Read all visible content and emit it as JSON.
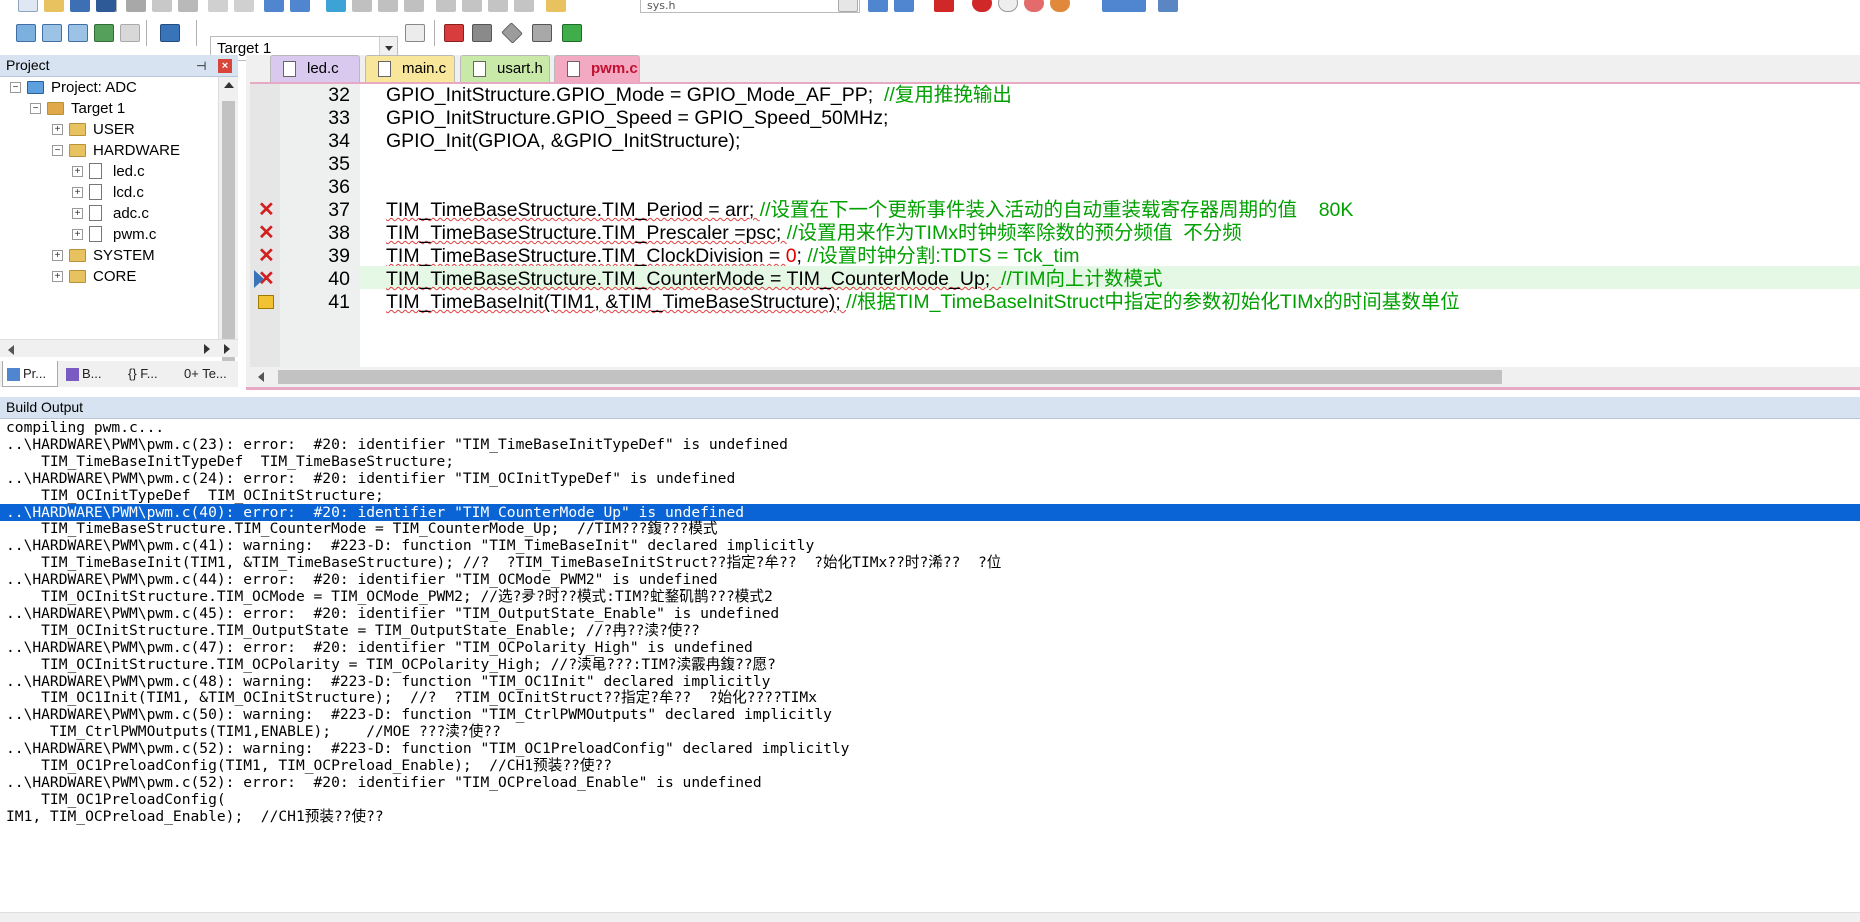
{
  "toolbar": {
    "target_name": "Target 1",
    "top_file": "sys.h"
  },
  "project": {
    "header": "Project",
    "tree": [
      {
        "label": "Project: ADC",
        "depth": 0,
        "type": "project",
        "expander": "−"
      },
      {
        "label": "Target 1",
        "depth": 1,
        "type": "target",
        "expander": "−"
      },
      {
        "label": "USER",
        "depth": 2,
        "type": "folder",
        "expander": "+"
      },
      {
        "label": "HARDWARE",
        "depth": 2,
        "type": "folder",
        "expander": "−"
      },
      {
        "label": "led.c",
        "depth": 3,
        "type": "file",
        "expander": "+"
      },
      {
        "label": "lcd.c",
        "depth": 3,
        "type": "file",
        "expander": "+"
      },
      {
        "label": "adc.c",
        "depth": 3,
        "type": "file",
        "expander": "+"
      },
      {
        "label": "pwm.c",
        "depth": 3,
        "type": "file",
        "expander": "+"
      },
      {
        "label": "SYSTEM",
        "depth": 2,
        "type": "folder",
        "expander": "+"
      },
      {
        "label": "CORE",
        "depth": 2,
        "type": "folder",
        "expander": "+"
      }
    ],
    "bottom_tabs": [
      "Pr...",
      "B...",
      "{} F...",
      "0+ Te..."
    ]
  },
  "editor": {
    "tabs": [
      {
        "label": "led.c",
        "color": "#d9c9ee",
        "active": false
      },
      {
        "label": "main.c",
        "color": "#f8e79a",
        "active": false
      },
      {
        "label": "usart.h",
        "color": "#c9e9a8",
        "active": false
      },
      {
        "label": "pwm.c",
        "color": "#f4a9c2",
        "active": true
      }
    ],
    "lines": [
      {
        "num": "32",
        "mark": "",
        "code": "GPIO_InitStructure.GPIO_Mode = GPIO_Mode_AF_PP;  ",
        "comment": "//复用推挽输出",
        "num_literal": "",
        "after": ""
      },
      {
        "num": "33",
        "mark": "",
        "code": "GPIO_InitStructure.GPIO_Speed = GPIO_Speed_50MHz;",
        "comment": "",
        "num_literal": "",
        "after": ""
      },
      {
        "num": "34",
        "mark": "",
        "code": "GPIO_Init(GPIOA, &GPIO_InitStructure);",
        "comment": "",
        "num_literal": "",
        "after": ""
      },
      {
        "num": "35",
        "mark": "",
        "code": "",
        "comment": "",
        "num_literal": "",
        "after": ""
      },
      {
        "num": "36",
        "mark": "",
        "code": "",
        "comment": "",
        "num_literal": "",
        "after": ""
      },
      {
        "num": "37",
        "mark": "error",
        "code": "TIM_TimeBaseStructure.TIM_Period = arr; ",
        "comment": "//设置在下一个更新事件装入活动的自动重装载寄存器周期的值    80K",
        "num_literal": "",
        "after": ""
      },
      {
        "num": "38",
        "mark": "error",
        "code": "TIM_TimeBaseStructure.TIM_Prescaler =psc; ",
        "comment": "//设置用来作为TIMx时钟频率除数的预分频值  不分频",
        "num_literal": "",
        "after": ""
      },
      {
        "num": "39",
        "mark": "error",
        "code": "TIM_TimeBaseStructure.TIM_ClockDivision = ",
        "comment": "//设置时钟分割:TDTS = Tck_tim",
        "num_literal": "0",
        "after": "; "
      },
      {
        "num": "40",
        "mark": "current",
        "code": "TIM_TimeBaseStructure.TIM_CounterMode = TIM_CounterMode_Up;  ",
        "comment": "//TIM向上计数模式",
        "num_literal": "",
        "after": ""
      },
      {
        "num": "41",
        "mark": "warning",
        "code": "TIM_TimeBaseInit(TIM1, &TIM_TimeBaseStructure); ",
        "comment": "//根据TIM_TimeBaseInitStruct中指定的参数初始化TIMx的时间基数单位",
        "num_literal": "",
        "after": ""
      }
    ]
  },
  "build": {
    "header": "Build Output",
    "lines": [
      "compiling pwm.c...",
      "..\\HARDWARE\\PWM\\pwm.c(23): error:  #20: identifier \"TIM_TimeBaseInitTypeDef\" is undefined",
      "    TIM_TimeBaseInitTypeDef  TIM_TimeBaseStructure;",
      "..\\HARDWARE\\PWM\\pwm.c(24): error:  #20: identifier \"TIM_OCInitTypeDef\" is undefined",
      "    TIM_OCInitTypeDef  TIM_OCInitStructure;",
      "..\\HARDWARE\\PWM\\pwm.c(40): error:  #20: identifier \"TIM_CounterMode_Up\" is undefined",
      "    TIM_TimeBaseStructure.TIM_CounterMode = TIM_CounterMode_Up;  //TIM???鍑???模式",
      "..\\HARDWARE\\PWM\\pwm.c(41): warning:  #223-D: function \"TIM_TimeBaseInit\" declared implicitly",
      "    TIM_TimeBaseInit(TIM1, &TIM_TimeBaseStructure); //?  ?TIM_TimeBaseInitStruct??指定?牟??  ?始化TIMx??时?浠??  ?位",
      "..\\HARDWARE\\PWM\\pwm.c(44): error:  #20: identifier \"TIM_OCMode_PWM2\" is undefined",
      "    TIM_OCInitStructure.TIM_OCMode = TIM_OCMode_PWM2; //选?夛?时??模式:TIM?虻鍪矶鹊???模式2",
      "..\\HARDWARE\\PWM\\pwm.c(45): error:  #20: identifier \"TIM_OutputState_Enable\" is undefined",
      "    TIM_OCInitStructure.TIM_OutputState = TIM_OutputState_Enable; //?冉??渎?使??",
      "..\\HARDWARE\\PWM\\pwm.c(47): error:  #20: identifier \"TIM_OCPolarity_High\" is undefined",
      "    TIM_OCInitStructure.TIM_OCPolarity = TIM_OCPolarity_High; //?渎黾???:TIM?渎霰冉鍑??愿?",
      "..\\HARDWARE\\PWM\\pwm.c(48): warning:  #223-D: function \"TIM_OC1Init\" declared implicitly",
      "    TIM_OC1Init(TIM1, &TIM_OCInitStructure);  //?  ?TIM_OCInitStruct??指定?牟??  ?始化????TIMx",
      "..\\HARDWARE\\PWM\\pwm.c(50): warning:  #223-D: function \"TIM_CtrlPWMOutputs\" declared implicitly",
      "     TIM_CtrlPWMOutputs(TIM1,ENABLE);    //MOE ???渎?使??",
      "..\\HARDWARE\\PWM\\pwm.c(52): warning:  #223-D: function \"TIM_OC1PreloadConfig\" declared implicitly",
      "    TIM_OC1PreloadConfig(TIM1, TIM_OCPreload_Enable);  //CH1预装??使??",
      "..\\HARDWARE\\PWM\\pwm.c(52): error:  #20: identifier \"TIM_OCPreload_Enable\" is undefined",
      "    TIM_OC1PreloadConfig(",
      "IM1, TIM_OCPreload_Enable);  //CH1预装??使??"
    ],
    "selected_index": 5
  }
}
